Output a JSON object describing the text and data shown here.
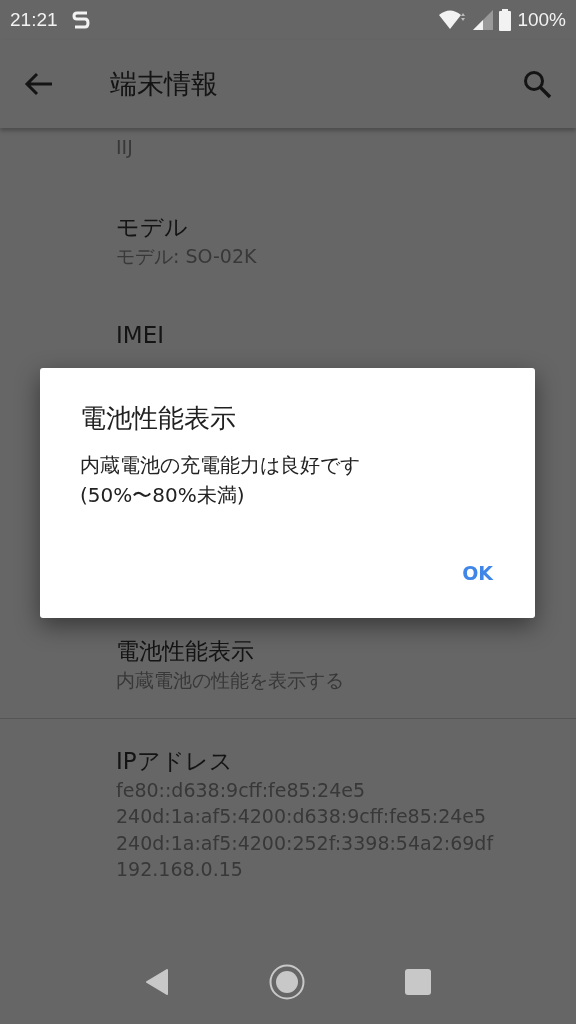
{
  "status_bar": {
    "time": "21:21",
    "battery": "100%"
  },
  "toolbar": {
    "title": "端末情報"
  },
  "items": [
    {
      "summary_lines": [
        "IIJ"
      ]
    },
    {
      "title": "モデル",
      "summary_lines": [
        "モデル: SO-02K"
      ]
    },
    {
      "title": "IMEI"
    },
    {
      "title": "電池性能表示",
      "summary_lines": [
        "内蔵電池の性能を表示する"
      ],
      "divider_after": true
    },
    {
      "title": "IPアドレス",
      "summary_lines": [
        "fe80::d638:9cff:fe85:24e5",
        "240d:1a:af5:4200:d638:9cff:fe85:24e5",
        "240d:1a:af5:4200:252f:3398:54a2:69df",
        "192.168.0.15"
      ]
    }
  ],
  "dialog": {
    "title": "電池性能表示",
    "message_lines": [
      "内蔵電池の充電能力は良好です",
      "(50%〜80%未満)"
    ],
    "button": "OK"
  }
}
